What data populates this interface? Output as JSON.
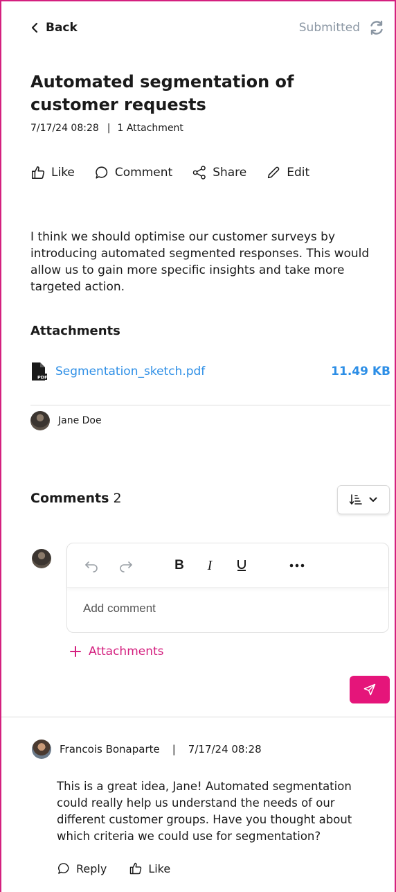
{
  "header": {
    "back_label": "Back",
    "status_label": "Submitted"
  },
  "idea": {
    "title": "Automated segmentation of customer requests",
    "date": "7/17/24 08:28",
    "attachment_count": "1 Attachment",
    "body": "I think we should optimise our customer surveys by introducing automated segmented responses. This would allow us to gain more specific insights and take more targeted action.",
    "author": "Jane Doe"
  },
  "actions": {
    "like": "Like",
    "comment": "Comment",
    "share": "Share",
    "edit": "Edit"
  },
  "attachments": {
    "heading": "Attachments",
    "items": [
      {
        "name": "Segmentation_sketch.pdf",
        "size": "11.49 KB",
        "icon": "pdf-file-icon"
      }
    ]
  },
  "comments": {
    "heading": "Comments",
    "count": "2",
    "editor": {
      "placeholder": "Add comment",
      "tools": [
        "undo-icon",
        "redo-icon",
        "bold-icon",
        "italic-icon",
        "underline-icon",
        "more-icon"
      ]
    },
    "add_attachments_label": "Attachments",
    "list": [
      {
        "author": "Francois Bonaparte",
        "date": "7/17/24 08:28",
        "text": "This is a great idea, Jane! Automated segmentation could really help us understand the needs of our different customer groups. Have you thought about which criteria we could use for segmentation?",
        "reply_label": "Reply",
        "like_label": "Like"
      }
    ]
  },
  "colors": {
    "accent": "#e5157a",
    "link": "#2c8ee6",
    "muted": "#8a96a3",
    "frame": "#d4207f"
  }
}
